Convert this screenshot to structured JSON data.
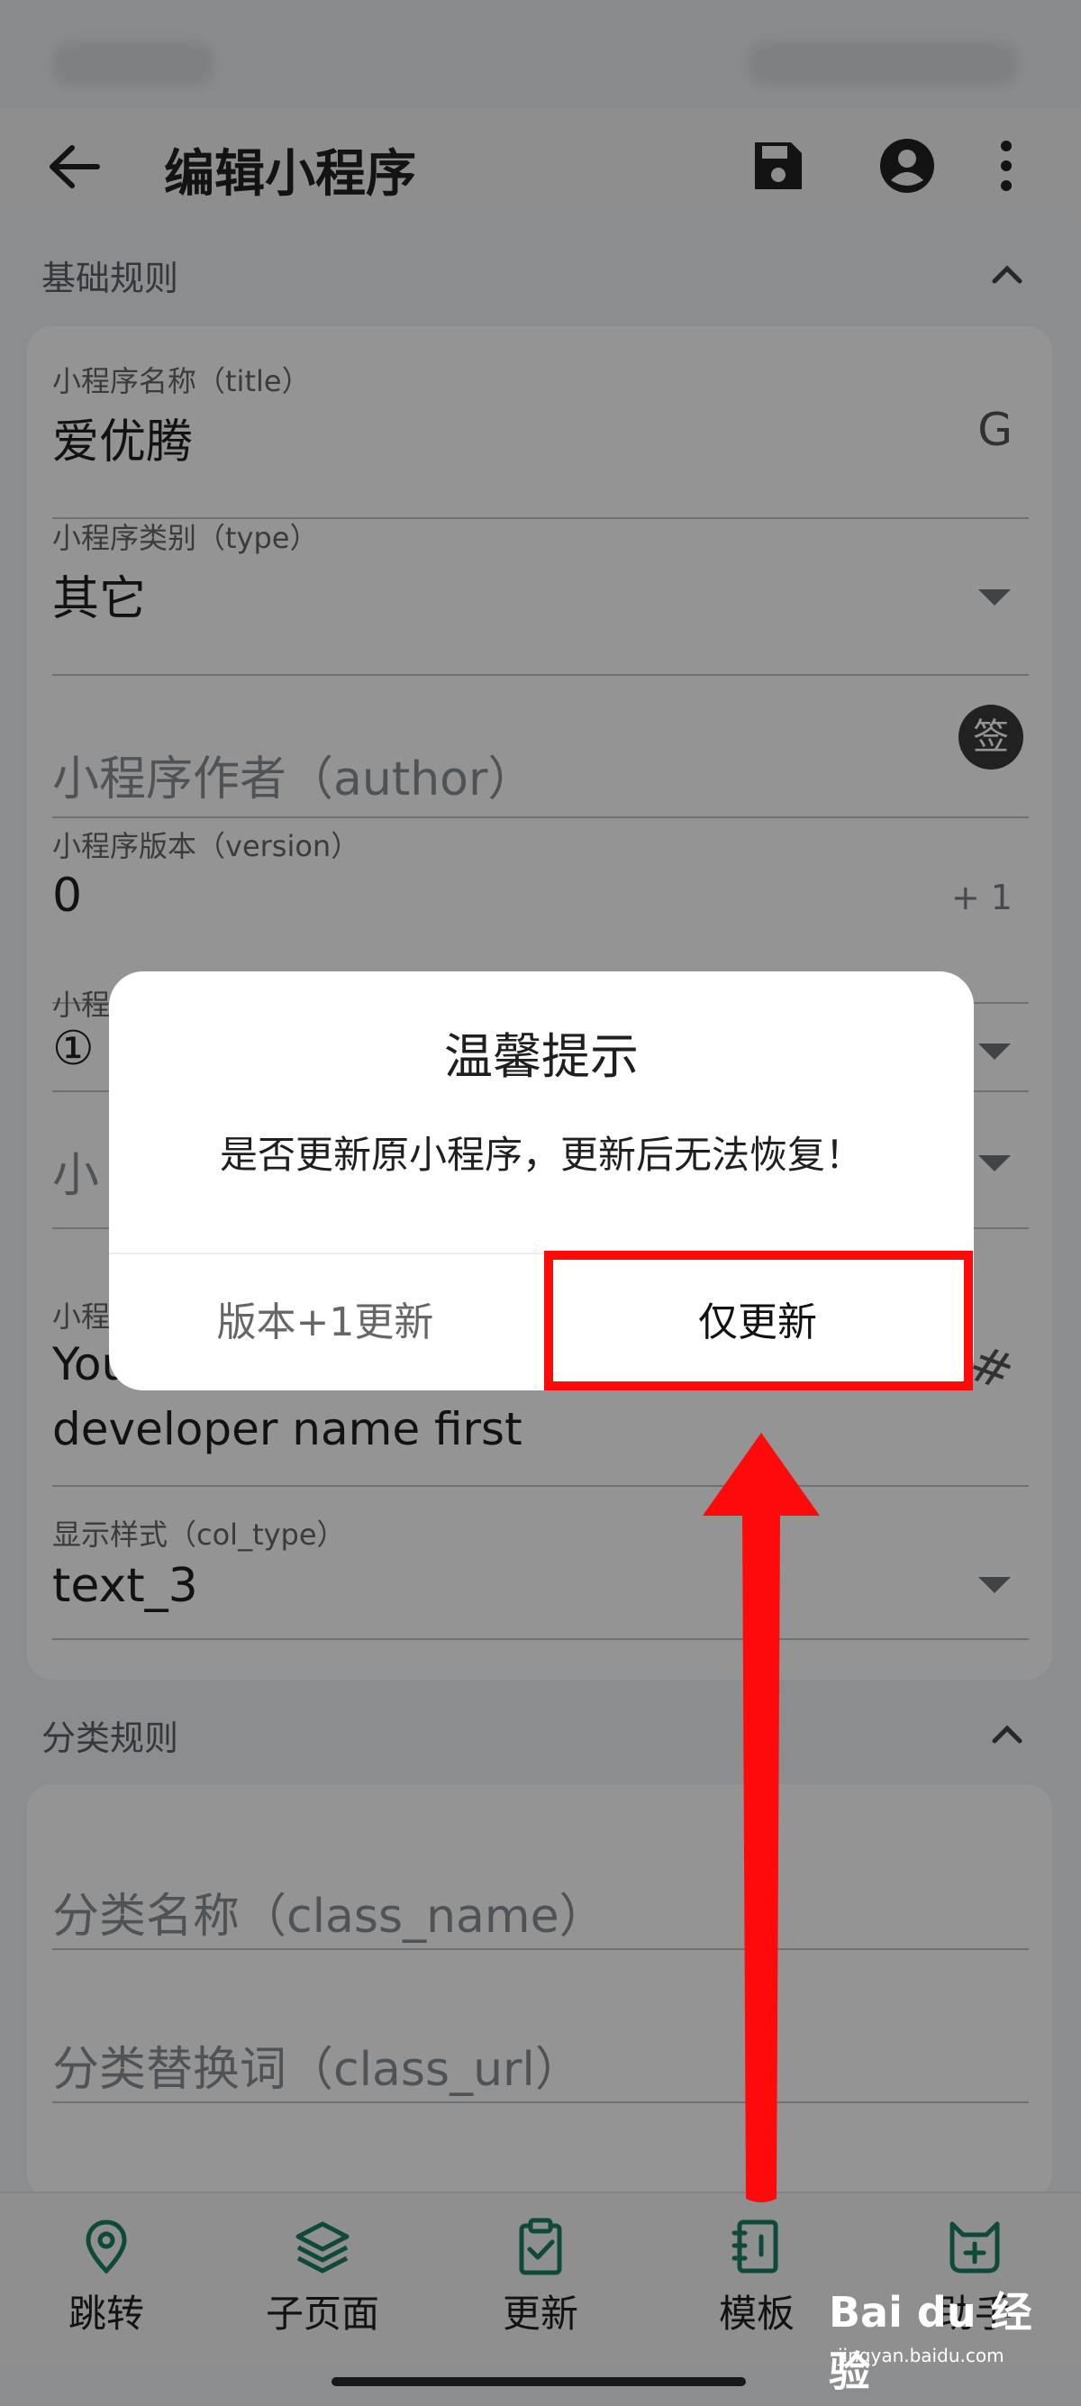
{
  "appbar": {
    "title": "编辑小程序",
    "icons": [
      "back-arrow-icon",
      "save-icon",
      "account-icon",
      "more-vert-icon"
    ]
  },
  "sections": {
    "basic": "基础规则",
    "category": "分类规则"
  },
  "fields": {
    "title_label": "小程序名称（title）",
    "title_value": "爱优腾",
    "title_trail": "G",
    "type_label": "小程序类别（type）",
    "type_value": "其它",
    "author_placeholder": "小程序作者（author）",
    "author_badge": "签",
    "version_label": "小程序版本（version）",
    "version_value": "0",
    "version_trail": "+ 1",
    "partial_label_1": "小程",
    "partial_value_1": "①",
    "partial_placeholder_2": "小",
    "partial_label_3": "小程",
    "developer_value": "You can't see it unless you set the developer name first",
    "developer_trail": "#",
    "col_type_label": "显示样式（col_type）",
    "col_type_value": "text_3",
    "class_name_placeholder": "分类名称（class_name）",
    "class_url_placeholder": "分类替换词（class_url）"
  },
  "dialog": {
    "title": "温馨提示",
    "message": "是否更新原小程序，更新后无法恢复！",
    "left_button": "版本+1更新",
    "right_button": "仅更新"
  },
  "bottom_nav": [
    {
      "label": "跳转",
      "icon": "location-pin-icon"
    },
    {
      "label": "子页面",
      "icon": "layers-icon"
    },
    {
      "label": "更新",
      "icon": "clipboard-check-icon"
    },
    {
      "label": "模板",
      "icon": "notebook-icon"
    },
    {
      "label": "助手",
      "icon": "cat-assistant-icon"
    }
  ],
  "watermark": {
    "brand": "Bai du 经验",
    "url": "jingyan.baidu.com"
  },
  "colors": {
    "accent": "#1a7f64",
    "highlight": "#ff0a0a",
    "overlay": "rgba(0,0,0,0.42)"
  }
}
